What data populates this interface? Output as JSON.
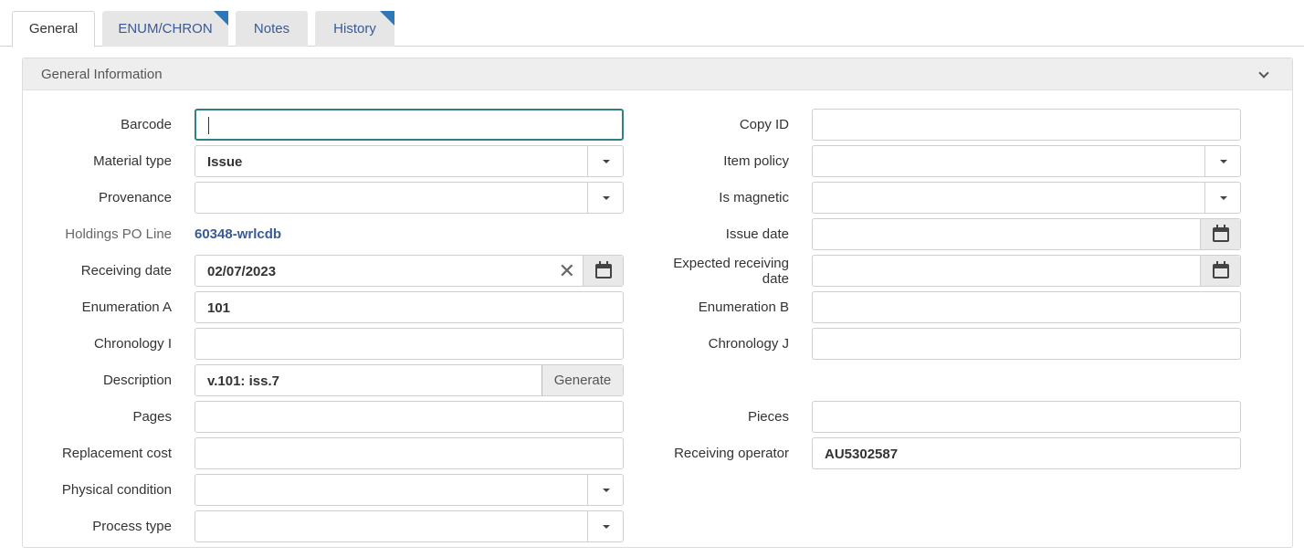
{
  "tabs": [
    {
      "label": "General",
      "active": true
    },
    {
      "label": "ENUM/CHRON",
      "flag": true
    },
    {
      "label": "Notes"
    },
    {
      "label": "History",
      "flag": true
    }
  ],
  "section": {
    "title": "General Information"
  },
  "left": {
    "barcode": {
      "label": "Barcode",
      "value": ""
    },
    "material_type": {
      "label": "Material type",
      "value": "Issue"
    },
    "provenance": {
      "label": "Provenance",
      "value": ""
    },
    "holdings_po_line": {
      "label": "Holdings PO Line",
      "value": "60348-wrlcdb"
    },
    "receiving_date": {
      "label": "Receiving date",
      "value": "02/07/2023"
    },
    "enumeration_a": {
      "label": "Enumeration A",
      "value": "101"
    },
    "chronology_i": {
      "label": "Chronology I",
      "value": ""
    },
    "description": {
      "label": "Description",
      "value": "v.101: iss.7",
      "button": "Generate"
    },
    "pages": {
      "label": "Pages",
      "value": ""
    },
    "replacement_cost": {
      "label": "Replacement cost",
      "value": ""
    },
    "physical_condition": {
      "label": "Physical condition",
      "value": ""
    },
    "process_type": {
      "label": "Process type",
      "value": ""
    }
  },
  "right": {
    "copy_id": {
      "label": "Copy ID",
      "value": ""
    },
    "item_policy": {
      "label": "Item policy",
      "value": ""
    },
    "is_magnetic": {
      "label": "Is magnetic",
      "value": ""
    },
    "issue_date": {
      "label": "Issue date",
      "value": ""
    },
    "expected_receiving_date": {
      "label_line1": "Expected receiving",
      "label_line2": "date",
      "value": ""
    },
    "enumeration_b": {
      "label": "Enumeration B",
      "value": ""
    },
    "chronology_j": {
      "label": "Chronology J",
      "value": ""
    },
    "pieces": {
      "label": "Pieces",
      "value": ""
    },
    "receiving_operator": {
      "label": "Receiving operator",
      "value": "AU5302587"
    }
  },
  "colors": {
    "accent": "#2f78b8",
    "link": "#3a5a96",
    "focus": "#2f7f86"
  }
}
